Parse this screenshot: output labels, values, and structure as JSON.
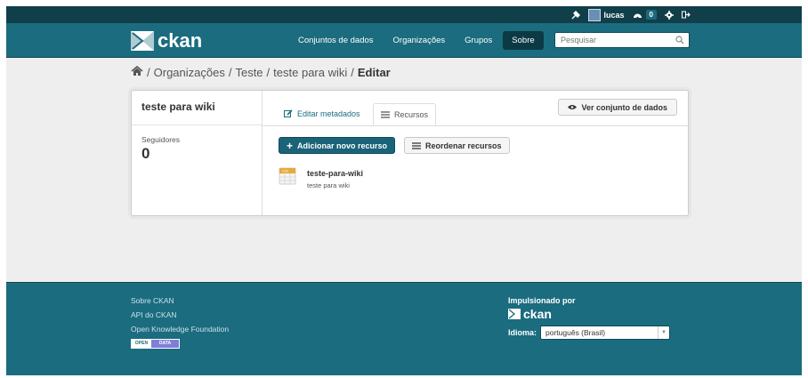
{
  "account": {
    "user": "lucas",
    "count": "0",
    "icons": [
      "admin-icon",
      "avatar-icon",
      "dashboard-icon",
      "settings-icon",
      "logout-icon"
    ]
  },
  "header": {
    "logo_text": "ckan",
    "nav": [
      "Conjuntos de dados",
      "Organizações",
      "Grupos",
      "Sobre"
    ],
    "active_nav": "Sobre",
    "search_placeholder": "Pesquisar"
  },
  "breadcrumb": {
    "items": [
      "Organizações",
      "Teste",
      "teste para wiki"
    ],
    "current": "Editar",
    "separator": "/"
  },
  "sidebar": {
    "title": "teste para wiki",
    "followers_label": "Seguidores",
    "followers_value": "0"
  },
  "tabs": {
    "edit_metadata": "Editar metadados",
    "resources": "Recursos",
    "view_dataset": "Ver conjunto de dados"
  },
  "actions": {
    "add_resource": "Adicionar novo recurso",
    "reorder_resources": "Reordenar recursos"
  },
  "resource": {
    "format": "CSV",
    "title": "teste-para-wiki",
    "description": "teste para wiki"
  },
  "footer": {
    "links": [
      "Sobre CKAN",
      "API do CKAN",
      "Open Knowledge Foundation"
    ],
    "open_data_badge": [
      "OPEN",
      "DATA"
    ],
    "powered_by": "Impulsionado por",
    "powered_logo": "ckan",
    "language_label": "Idioma:",
    "language_value": "português (Brasil)"
  },
  "colors": {
    "masthead": "#1b6c7f",
    "account_bar": "#103f4a",
    "primary_button": "#1a6378",
    "background": "#eeeeee"
  }
}
